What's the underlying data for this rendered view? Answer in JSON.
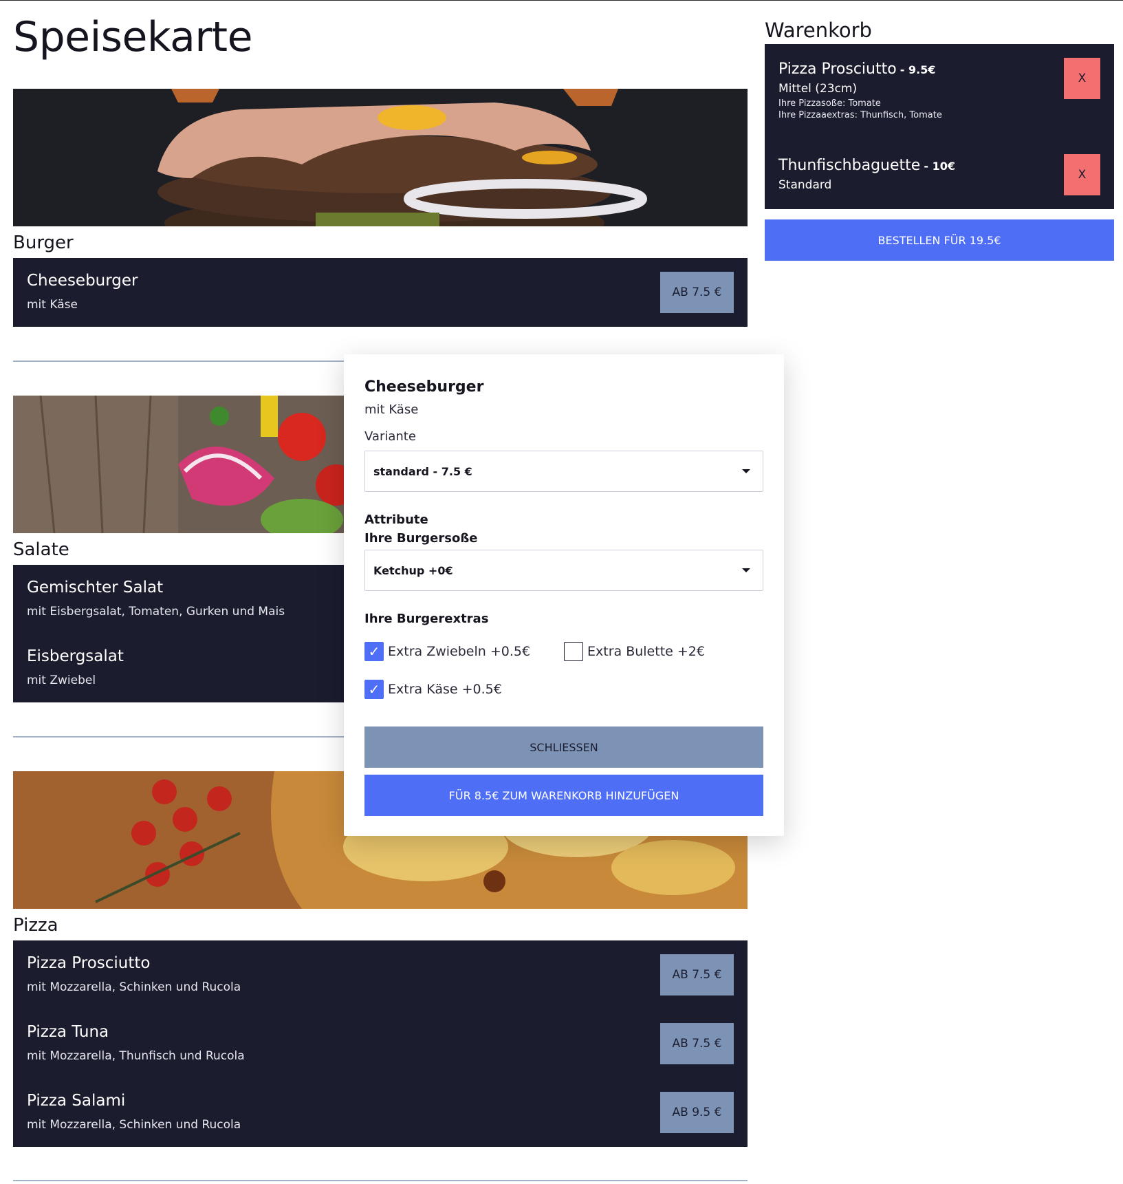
{
  "menu": {
    "title": "Speisekarte",
    "categories": [
      {
        "title": "Burger",
        "items": [
          {
            "name": "Cheeseburger",
            "desc": "mit Käse",
            "price": "AB 7.5 €"
          }
        ]
      },
      {
        "title": "Salate",
        "items": [
          {
            "name": "Gemischter Salat",
            "desc": "mit Eisbergsalat, Tomaten, Gurken und Mais"
          },
          {
            "name": "Eisbergsalat",
            "desc": "mit Zwiebel"
          }
        ]
      },
      {
        "title": "Pizza",
        "items": [
          {
            "name": "Pizza Prosciutto",
            "desc": "mit Mozzarella, Schinken und Rucola",
            "price": "AB 7.5 €"
          },
          {
            "name": "Pizza Tuna",
            "desc": "mit Mozzarella, Thunfisch und Rucola",
            "price": "AB 7.5 €"
          },
          {
            "name": "Pizza Salami",
            "desc": "mit Mozzarella, Schinken und Rucola",
            "price": "AB 9.5 €"
          }
        ]
      }
    ]
  },
  "cart": {
    "title": "Warenkorb",
    "items": [
      {
        "name": "Pizza Prosciutto",
        "price": "- 9.5€",
        "variant": "Mittel (23cm)",
        "details": [
          "Ihre Pizzasoße: Tomate",
          "Ihre Pizzaaextras: Thunfisch, Tomate"
        ],
        "remove_label": "X"
      },
      {
        "name": "Thunfischbaguette",
        "price": "- 10€",
        "variant": "Standard",
        "details": [],
        "remove_label": "X"
      }
    ],
    "order_label": "BESTELLEN FÜR 19.5€"
  },
  "modal": {
    "title": "Cheeseburger",
    "desc": "mit Käse",
    "variant_label": "Variante",
    "variant_value": "standard - 7.5 €",
    "attributes_label": "Attribute",
    "sauce_label": "Ihre Burgersoße",
    "sauce_value": "Ketchup +0€",
    "extras_label": "Ihre Burgerextras",
    "extras": [
      {
        "label": "Extra Zwiebeln +0.5€",
        "checked": true
      },
      {
        "label": "Extra Bulette +2€",
        "checked": false
      },
      {
        "label": "Extra Käse +0.5€",
        "checked": true
      }
    ],
    "close_label": "SCHLIESSEN",
    "add_label": "FÜR 8.5€ ZUM WARENKORB HINZUFÜGEN"
  },
  "colors": {
    "dark": "#1b1c2e",
    "accent": "#4e6ef6",
    "muted_button": "#7d93b6",
    "remove": "#f46f6f"
  }
}
